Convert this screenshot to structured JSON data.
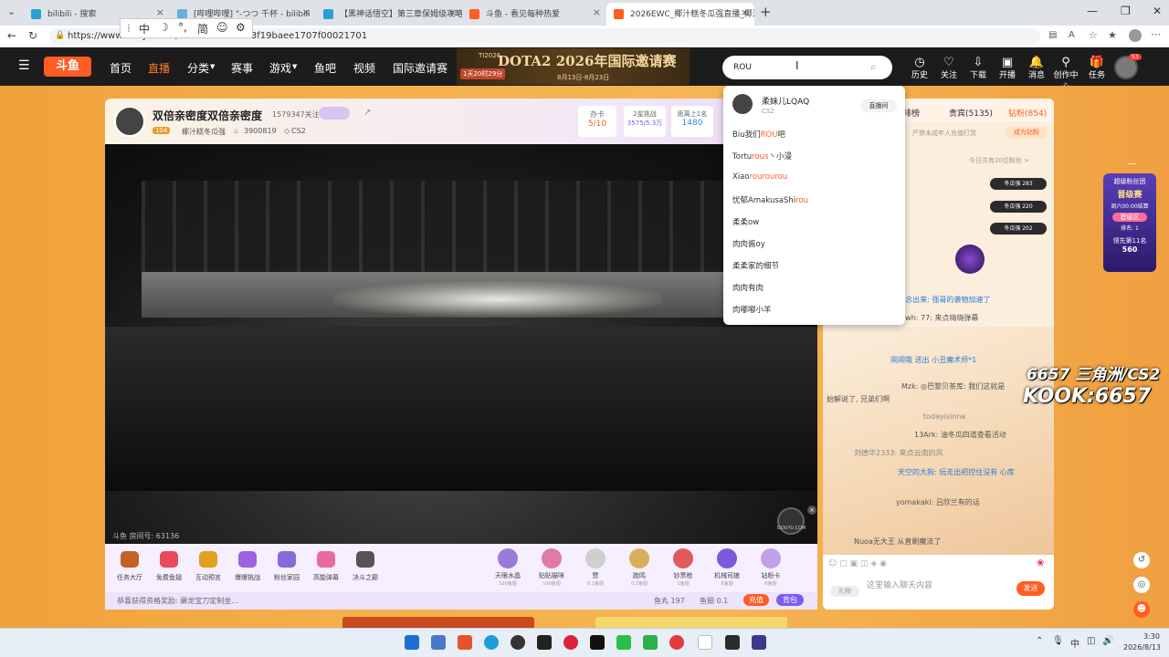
{
  "browser": {
    "tabs": [
      {
        "label": "bilibili - 搜索",
        "color": "#2a9fd6"
      },
      {
        "label": "[哔哩哔哩] \"-つつ 千杯 - bilibili",
        "color": "#6ab0e0"
      },
      {
        "label": "【黑神话悟空】第三章保姆级攻略",
        "color": "#2a9fd6"
      },
      {
        "label": "斗鱼 - 看见每种热爱",
        "color": "#ff5d23"
      },
      {
        "label": "2026EWC_椰汁糕冬瓜强直播_椰汁",
        "color": "#ff5d23"
      }
    ],
    "url": "https://www.douyu.com/...89a279b99303f19baee1707f00021701"
  },
  "ime": {
    "mode": "中",
    "script": "简"
  },
  "header": {
    "logo": "斗鱼",
    "nav": [
      "首页",
      "直播",
      "分类",
      "赛事",
      "游戏",
      "鱼吧",
      "视频",
      "国际邀请赛"
    ],
    "banner": {
      "tag": "TI2026",
      "title": "DOTA2 2026年国际邀请赛",
      "countdown": "1天20时29分",
      "dates": "8月13日-8月23日"
    },
    "search_value": "ROU",
    "icons": [
      {
        "label": "历史",
        "icon": "clock-icon"
      },
      {
        "label": "关注",
        "icon": "heart-icon"
      },
      {
        "label": "下载",
        "icon": "download-icon"
      },
      {
        "label": "开播",
        "icon": "broadcast-icon"
      },
      {
        "label": "消息",
        "icon": "bell-icon"
      },
      {
        "label": "创作中心",
        "icon": "location-icon"
      },
      {
        "label": "任务",
        "icon": "gift-icon"
      }
    ],
    "avatar_badge": "53"
  },
  "search_dropdown": {
    "top_result": {
      "name": "柔妹儿LQAQ",
      "category": "CS2",
      "action": "直播间"
    },
    "suggestions": [
      {
        "pre": "Biu我们",
        "hl": "ROU",
        "post": "吧"
      },
      {
        "pre": "Tortu",
        "hl": "rous",
        "post": "丶小漫"
      },
      {
        "pre": "Xiao",
        "hl": "rourourou",
        "post": ""
      },
      {
        "pre": "忧郁AmakusaShi",
        "hl": "rou",
        "post": ""
      },
      {
        "pre": "柔柔ow",
        "hl": "",
        "post": ""
      },
      {
        "pre": "肉肉酱oy",
        "hl": "",
        "post": ""
      },
      {
        "pre": "柔柔家的细节",
        "hl": "",
        "post": ""
      },
      {
        "pre": "肉肉有肉",
        "hl": "",
        "post": ""
      },
      {
        "pre": "肉嘟嘟小羊",
        "hl": "",
        "post": ""
      }
    ]
  },
  "room": {
    "title": "双倍亲密度双倍亲密度",
    "followers": "1579347关注",
    "level": "104",
    "streamer": "椰汁糕冬瓜强",
    "hot": "3900819",
    "category": "CS2",
    "stats": [
      {
        "label": "办卡",
        "value": "5/10"
      },
      {
        "label": "2星挑战",
        "value": "3575/5.3万"
      },
      {
        "label": "距离上1名",
        "value": "1480"
      }
    ],
    "room_id_label": "斗鱼 房间号: 63136",
    "watermark": "DOUYU.COM"
  },
  "giftbar": {
    "left_items": [
      "任务大厅",
      "免费鱼翅",
      "互动预言",
      "爆爆挑战",
      "粉丝家园",
      "高能弹幕",
      "决斗之巅"
    ],
    "gifts": [
      {
        "name": "天眼水晶",
        "price": "100鱼翅"
      },
      {
        "name": "贴贴猫咪",
        "price": "100鱼翅"
      },
      {
        "name": "赞",
        "price": "0.1鱼翅"
      },
      {
        "name": "跑鸣",
        "price": "0.2鱼翅"
      },
      {
        "name": "钞票枪",
        "price": "1鱼翅"
      },
      {
        "name": "机械司狼",
        "price": "6鱼翅"
      },
      {
        "name": "钻粉卡",
        "price": "6鱼翅"
      }
    ],
    "notice": "恭喜获得资格奖励: 屠龙宝刀定制坐...",
    "fish_balls": "鱼丸 197",
    "fish_fins": "鱼翅 0.1",
    "recharge": "充值",
    "backpack": "背包"
  },
  "chat": {
    "tabs": [
      "排榜",
      "贵宾(5135)",
      "钻粉(854)"
    ],
    "notice": "严禁未成年人充值打赏",
    "become_fan": "成为钻粉",
    "fan_count": "今日共有20位粉丝 >",
    "badges": [
      "冬瓜强 283",
      "冬瓜强 220",
      "冬瓜强 202"
    ],
    "lines": [
      "s笔才念出来: 强哥的袭物加速了",
      "一哥swh: 77: 来点嗨嗨弹幕",
      "闹闹哦 送出 小丑魔术师*1",
      "Mzk: ◎巴黎贝茶库: 我们这就是",
      "始解说了, 兄弟们啊",
      "todayisinne",
      "13Ark: 油冬瓜四道查看活动",
      "刘德华2333: 来点云南的风",
      "天空的大狗: 玩走出把控住没有 心库",
      "yomakaki: 吕欣兰有的话",
      "Nuoa无大王 从直刷魔法了"
    ],
    "input_placeholder": "这里输入聊天内容",
    "send": "发送",
    "gift_label": "礼物"
  },
  "side_promo": {
    "title": "超级粉丝团",
    "subtitle": "晋级赛",
    "time": "周六00:00结算",
    "tag": "晋级区",
    "rank": "排名: 1",
    "lead": "领先第11名",
    "lead_value": "560"
  },
  "overlay": {
    "line1": "6657 三角洲/CS2",
    "line2": "KOOK:6657"
  },
  "taskbar": {
    "time": "3:30",
    "date": "2026/8/13",
    "ime": "中"
  }
}
